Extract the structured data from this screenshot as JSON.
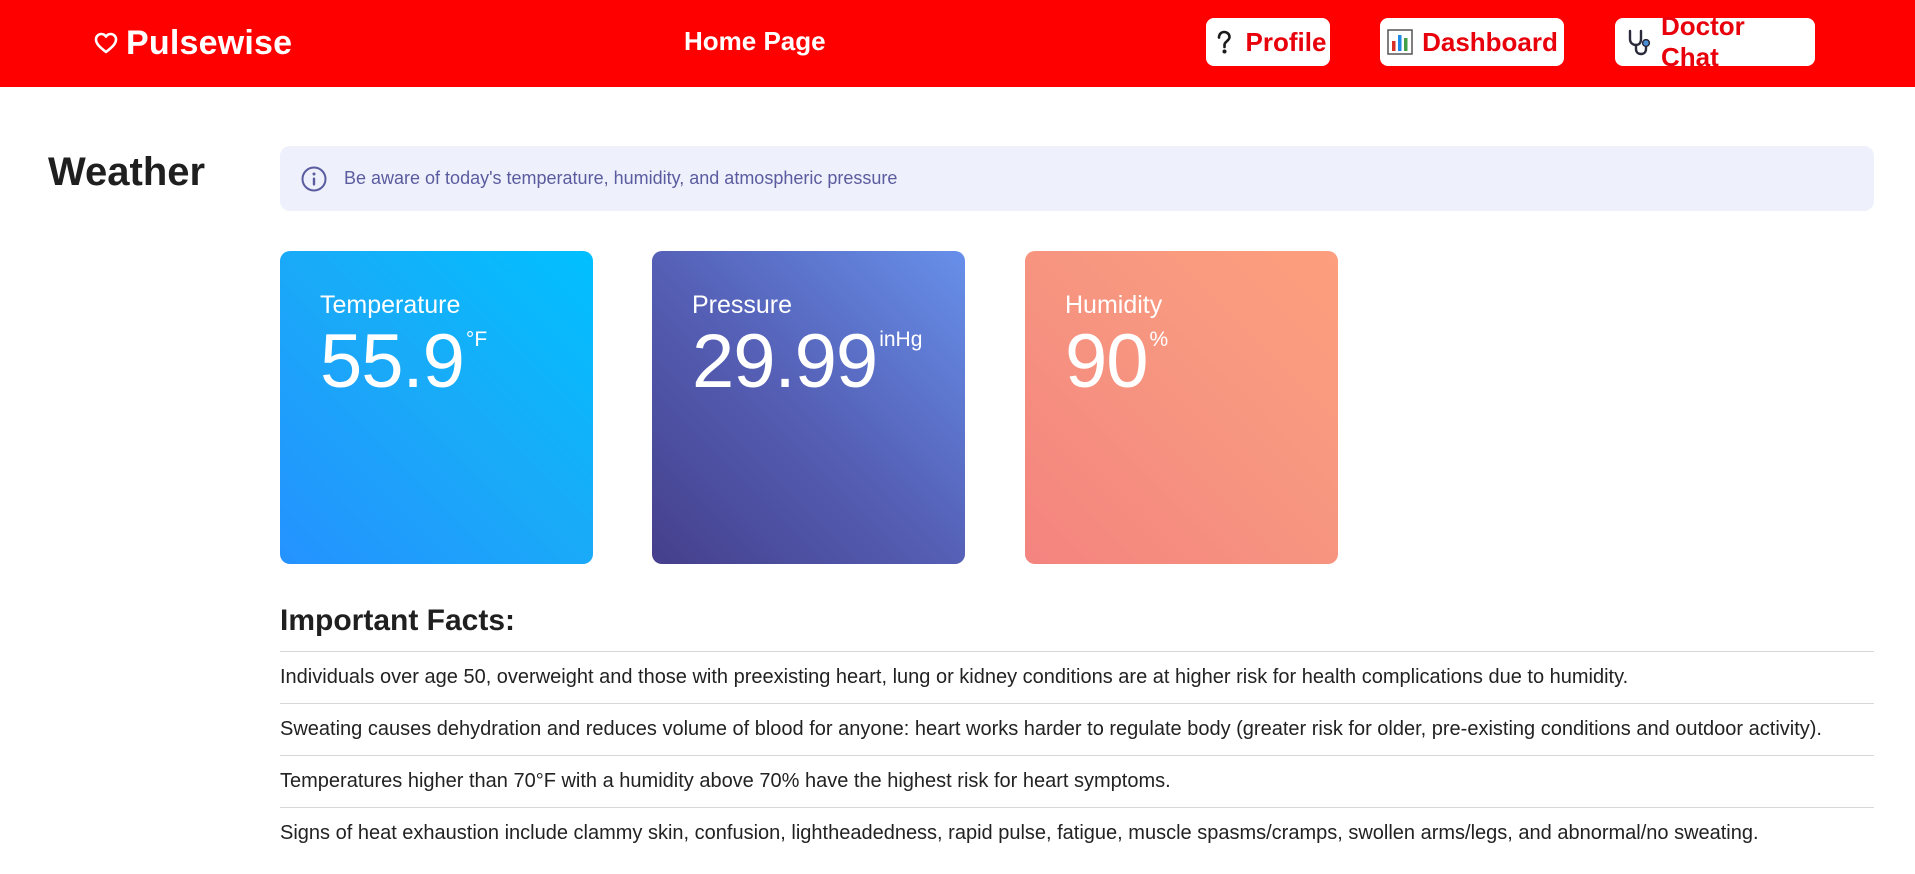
{
  "header": {
    "brand": "Pulsewise",
    "brand_icon": "heart-outline-icon",
    "center_link": "Home Page",
    "buttons": [
      {
        "label": "Profile",
        "icon": "question-mark-icon"
      },
      {
        "label": "Dashboard",
        "icon": "bar-chart-icon"
      },
      {
        "label": "Doctor Chat",
        "icon": "stethoscope-icon"
      }
    ],
    "colors": {
      "bar": "#ff0000",
      "button_text": "#e8000b"
    }
  },
  "main": {
    "title": "Weather",
    "info": {
      "icon": "info-circle-icon",
      "text": "Be aware of today's temperature, humidity, and atmospheric pressure"
    },
    "cards": [
      {
        "label": "Temperature",
        "value": "55.9",
        "unit": "°F",
        "colors": [
          "#2592ff",
          "#00c0ff"
        ]
      },
      {
        "label": "Pressure",
        "value": "29.99",
        "unit": "inHg",
        "colors": [
          "#453f8c",
          "#6790ea"
        ]
      },
      {
        "label": "Humidity",
        "value": "90",
        "unit": "%",
        "colors": [
          "#f4837f",
          "#fd9f7e"
        ]
      }
    ],
    "facts_title": "Important Facts:",
    "facts": [
      "Individuals over age 50, overweight and those with preexisting heart, lung or kidney conditions are at higher risk for health complications due to humidity.",
      "Sweating causes dehydration and reduces volume of blood for anyone: heart works harder to regulate body (greater risk for older, pre-existing conditions and outdoor activity).",
      "Temperatures higher than 70°F with a humidity above 70% have the highest risk for heart symptoms.",
      "Signs of heat exhaustion include clammy skin, confusion, lightheadedness, rapid pulse, fatigue, muscle spasms/cramps, swollen arms/legs, and abnormal/no sweating."
    ]
  }
}
